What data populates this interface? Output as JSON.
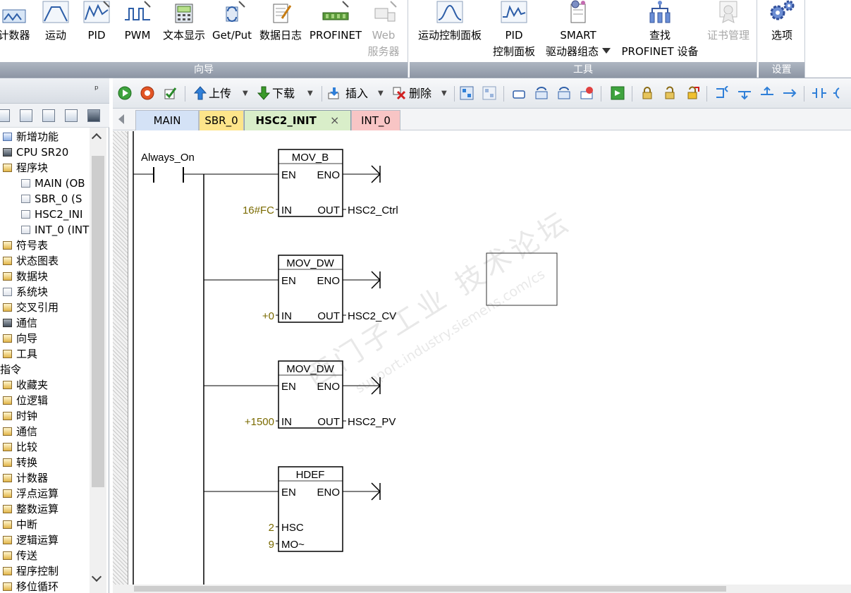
{
  "ribbon": {
    "wizard_group_label": "向导",
    "tools_group_label": "工具",
    "settings_group_label": "设置",
    "wizard_buttons": [
      {
        "label": "计数器",
        "icon": "counter-icon"
      },
      {
        "label": "运动",
        "icon": "motion-icon"
      },
      {
        "label": "PID",
        "icon": "pid-icon"
      },
      {
        "label": "PWM",
        "icon": "pwm-icon"
      },
      {
        "label": "文本显示",
        "icon": "text-display-icon"
      },
      {
        "label": "Get/Put",
        "icon": "get-put-icon"
      },
      {
        "label": "数据日志",
        "icon": "data-log-icon"
      },
      {
        "label": "PROFINET",
        "icon": "profinet-icon"
      },
      {
        "label": "Web",
        "label2": "服务器",
        "icon": "web-server-icon"
      }
    ],
    "tools_buttons": [
      {
        "label": "运动控制面板",
        "icon": "motion-panel-icon"
      },
      {
        "label": "PID",
        "label2": "控制面板",
        "icon": "pid-panel-icon"
      },
      {
        "label": "SMART",
        "label2": "驱动器组态",
        "icon": "smart-drive-icon"
      },
      {
        "label": "查找",
        "label2": "PROFINET 设备",
        "icon": "find-profinet-icon"
      },
      {
        "label": "证书管理",
        "icon": "certificate-icon"
      }
    ],
    "settings_buttons": [
      {
        "label": "选项",
        "icon": "options-gear-icon"
      }
    ]
  },
  "toolbar": {
    "upload_label": "上传",
    "download_label": "下载",
    "insert_label": "插入",
    "delete_label": "删除"
  },
  "tabs": [
    {
      "label": "MAIN"
    },
    {
      "label": "SBR_0"
    },
    {
      "label": "HSC2_INIT",
      "close": "×"
    },
    {
      "label": "INT_0"
    }
  ],
  "left_panel": {
    "pin_glyph": "ᵖ",
    "tree": [
      {
        "label": "新增功能",
        "indent": 0
      },
      {
        "label": "CPU SR20",
        "indent": 0
      },
      {
        "label": "程序块",
        "indent": 0
      },
      {
        "label": "MAIN (OB",
        "indent": 1
      },
      {
        "label": "SBR_0 (S",
        "indent": 1
      },
      {
        "label": "HSC2_INI",
        "indent": 1
      },
      {
        "label": "INT_0 (INT",
        "indent": 1
      },
      {
        "label": "符号表",
        "indent": 0
      },
      {
        "label": "状态图表",
        "indent": 0
      },
      {
        "label": "数据块",
        "indent": 0
      },
      {
        "label": "系统块",
        "indent": 0
      },
      {
        "label": "交叉引用",
        "indent": 0
      },
      {
        "label": "通信",
        "indent": 0
      },
      {
        "label": "向导",
        "indent": 0
      },
      {
        "label": "工具",
        "indent": 0
      },
      {
        "label": "指令",
        "indent": -1
      },
      {
        "label": "收藏夹",
        "indent": 0
      },
      {
        "label": "位逻辑",
        "indent": 0
      },
      {
        "label": "时钟",
        "indent": 0
      },
      {
        "label": "通信",
        "indent": 0
      },
      {
        "label": "比较",
        "indent": 0
      },
      {
        "label": "转换",
        "indent": 0
      },
      {
        "label": "计数器",
        "indent": 0
      },
      {
        "label": "浮点运算",
        "indent": 0
      },
      {
        "label": "整数运算",
        "indent": 0
      },
      {
        "label": "中断",
        "indent": 0
      },
      {
        "label": "逻辑运算",
        "indent": 0
      },
      {
        "label": "传送",
        "indent": 0
      },
      {
        "label": "程序控制",
        "indent": 0
      },
      {
        "label": "移位循环",
        "indent": 0
      }
    ]
  },
  "ladder": {
    "contact_label": "Always_On",
    "blocks": [
      {
        "name": "MOV_B",
        "en": "EN",
        "eno": "ENO",
        "in_value": "16#FC",
        "in_pin": "IN",
        "out_pin": "OUT",
        "out_value": "HSC2_Ctrl"
      },
      {
        "name": "MOV_DW",
        "en": "EN",
        "eno": "ENO",
        "in_value": "+0",
        "in_pin": "IN",
        "out_pin": "OUT",
        "out_value": "HSC2_CV"
      },
      {
        "name": "MOV_DW",
        "en": "EN",
        "eno": "ENO",
        "in_value": "+1500",
        "in_pin": "IN",
        "out_pin": "OUT",
        "out_value": "HSC2_PV"
      },
      {
        "name": "HDEF",
        "en": "EN",
        "eno": "ENO",
        "in_value": "2",
        "in_pin": "HSC",
        "in2_value": "9",
        "in2_pin": "MO~"
      }
    ],
    "watermark": {
      "line1": "西门子工业 技术论坛",
      "line2": "support.industry.siemens.com/cs"
    }
  },
  "colors": {
    "tab_main": "#d4e2f6",
    "tab_sbr": "#fde58a",
    "tab_hsc": "#d9eec9",
    "tab_int": "#f8c5c5",
    "value_text": "#7a6a00",
    "ribbon_group_label_bg": "#979fad"
  }
}
